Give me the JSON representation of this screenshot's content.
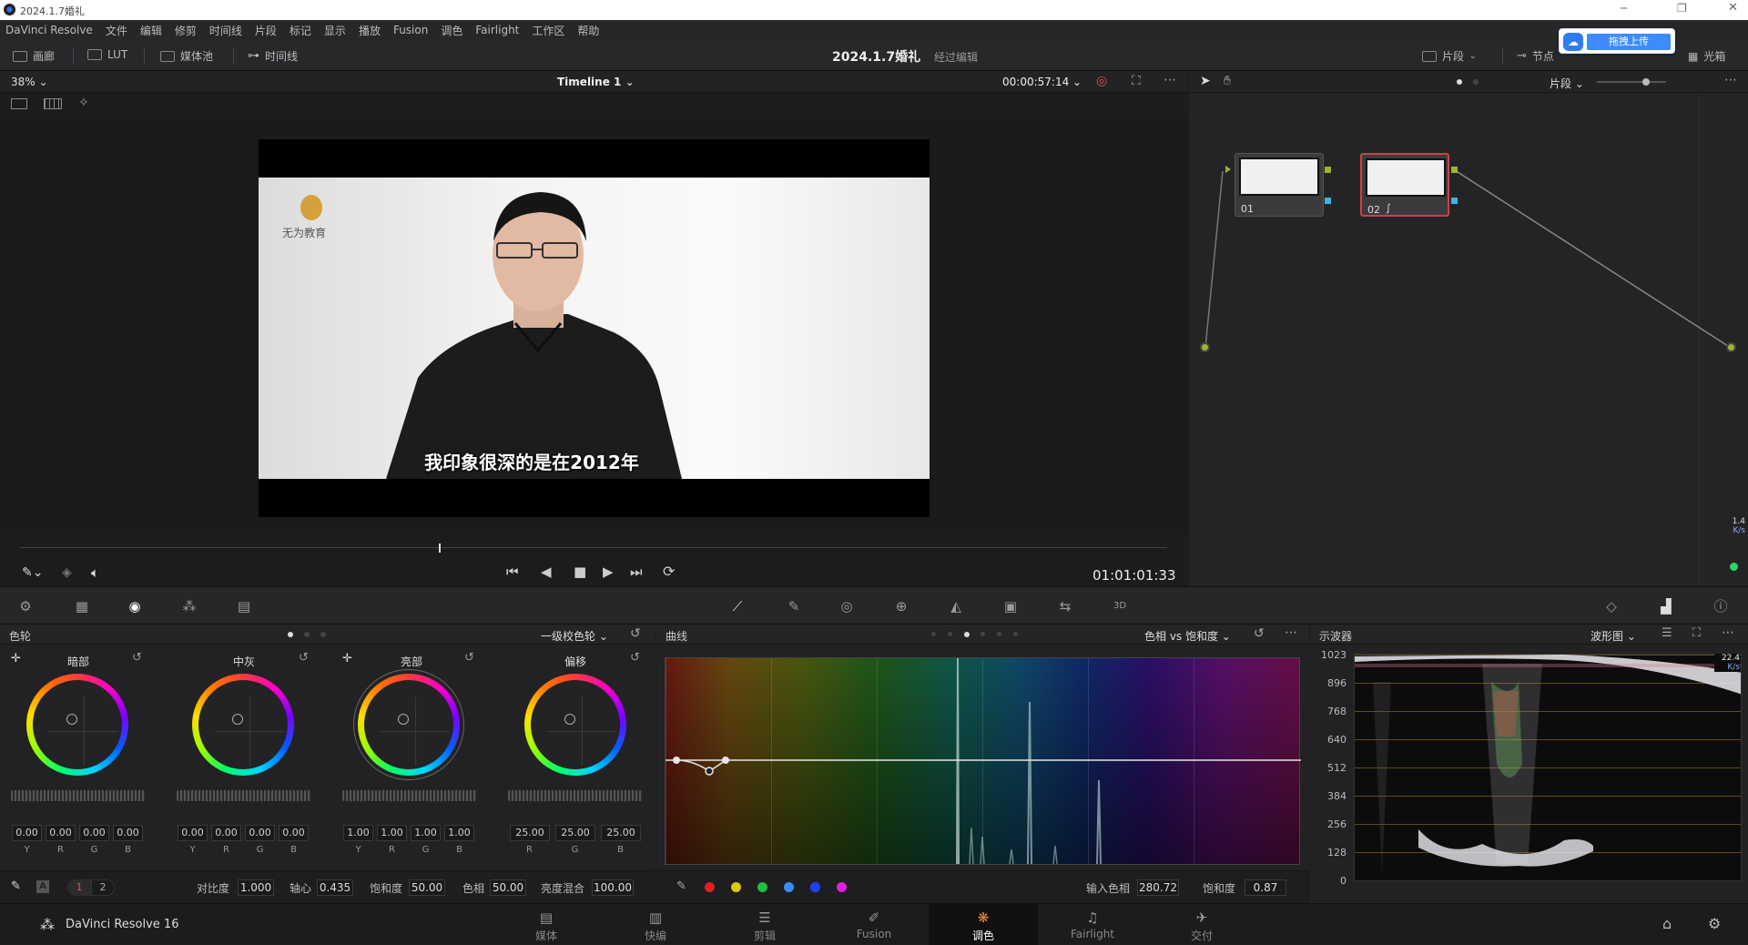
{
  "window": {
    "title": "2024.1.7婚礼"
  },
  "menu": [
    "DaVinci Resolve",
    "文件",
    "编辑",
    "修剪",
    "时间线",
    "片段",
    "标记",
    "显示",
    "播放",
    "Fusion",
    "调色",
    "Fairlight",
    "工作区",
    "帮助"
  ],
  "toolbar": {
    "gallery": "画廊",
    "lut": "LUT",
    "media_pool": "媒体池",
    "timeline": "时间线",
    "project_title": "2024.1.7婚礼",
    "project_sub": "经过编辑",
    "clips": "片段",
    "nodes": "节点",
    "lightbox": "光箱",
    "upload_button": "拖拽上传"
  },
  "viewer": {
    "zoom": "38%",
    "timeline_name": "Timeline 1",
    "timecode_top": "00:00:57:14",
    "timecode": "01:01:01:33",
    "subtitle": "我印象很深的是在2012年",
    "logo_text": "无为教育"
  },
  "node_editor": {
    "mode": "片段",
    "nodes": [
      {
        "label": "01"
      },
      {
        "label": "02"
      }
    ]
  },
  "wheels_panel": {
    "title": "色轮",
    "mode": "一级校色轮",
    "wheels": [
      {
        "name": "暗部",
        "values": [
          "0.00",
          "0.00",
          "0.00",
          "0.00"
        ],
        "channels": [
          "Y",
          "R",
          "G",
          "B"
        ]
      },
      {
        "name": "中灰",
        "values": [
          "0.00",
          "0.00",
          "0.00",
          "0.00"
        ],
        "channels": [
          "Y",
          "R",
          "G",
          "B"
        ]
      },
      {
        "name": "亮部",
        "values": [
          "1.00",
          "1.00",
          "1.00",
          "1.00"
        ],
        "channels": [
          "Y",
          "R",
          "G",
          "B"
        ]
      },
      {
        "name": "偏移",
        "values": [
          "25.00",
          "25.00",
          "25.00"
        ],
        "channels": [
          "R",
          "G",
          "B"
        ]
      }
    ],
    "pages": [
      "1",
      "2"
    ],
    "params": [
      {
        "label": "对比度",
        "value": "1.000"
      },
      {
        "label": "轴心",
        "value": "0.435"
      },
      {
        "label": "饱和度",
        "value": "50.00"
      },
      {
        "label": "色相",
        "value": "50.00"
      },
      {
        "label": "亮度混合",
        "value": "100.00"
      }
    ]
  },
  "curves_panel": {
    "title": "曲线",
    "mode": "色相 vs 饱和度",
    "input_hue_label": "输入色相",
    "input_hue": "280.72",
    "sat_label": "饱和度",
    "sat": "0.87",
    "swatches": [
      "#e02020",
      "#e0c800",
      "#20c040",
      "#3a8cff",
      "#2040ff",
      "#e020e0"
    ]
  },
  "scope_panel": {
    "title": "示波器",
    "mode": "波形图",
    "y_ticks": [
      "1023",
      "896",
      "768",
      "640",
      "512",
      "384",
      "256",
      "128",
      "0"
    ],
    "rate1": "1.4",
    "rate1_unit": "K/s",
    "rate2": "22.4",
    "rate2_unit": "K/s"
  },
  "bottom": {
    "app_name": "DaVinci Resolve 16",
    "pages": [
      "媒体",
      "快编",
      "剪辑",
      "Fusion",
      "调色",
      "Fairlight",
      "交付"
    ],
    "active_page": "调色"
  }
}
